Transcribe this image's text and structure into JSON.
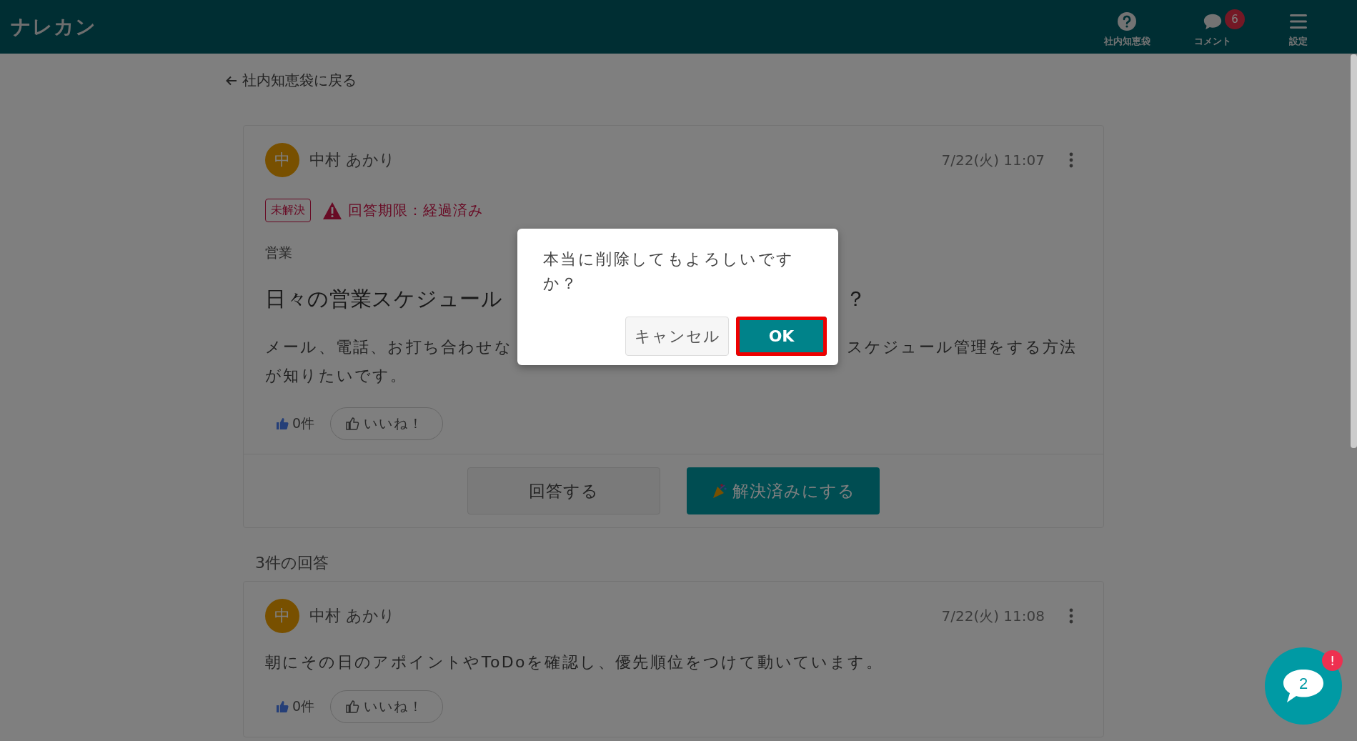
{
  "header": {
    "logo": "ナレカン",
    "nav": [
      {
        "label": "社内知恵袋",
        "kind": "help"
      },
      {
        "label": "コメント",
        "kind": "comment",
        "badge": "6"
      },
      {
        "label": "設定",
        "kind": "menu"
      }
    ]
  },
  "back_link": "社内知恵袋に戻る",
  "question": {
    "avatar": "中",
    "author": "中村 あかり",
    "date": "7/22(火) 11:07",
    "status": "未解決",
    "deadline": "回答期限：経過済み",
    "category": "営業",
    "title_parts": [
      "日々の営業スケジュール",
      "？"
    ],
    "body_lines": [
      [
        "メール、電話、お打ち合わせな",
        "スケジュール管理をする方法"
      ],
      [
        "が知りたいです。"
      ]
    ],
    "like_count": "0件",
    "like_button": "いいね！",
    "actions": [
      {
        "label": "回答する",
        "kind": "secondary"
      },
      {
        "label": "解決済みにする",
        "kind": "primary"
      }
    ]
  },
  "answers_heading": "3件の回答",
  "answers": [
    {
      "avatar": "中",
      "author": "中村 あかり",
      "date": "7/22(火) 11:08",
      "body": "朝にその日のアポイントやToDoを確認し、優先順位をつけて動いています。",
      "like_count": "0件",
      "like_button": "いいね！"
    }
  ],
  "dialog": {
    "message": "本当に削除してもよろしいですか？",
    "buttons": [
      {
        "label": "キャンセル",
        "kind": "secondary",
        "selected": false
      },
      {
        "label": "OK",
        "kind": "primary",
        "selected": true
      }
    ]
  },
  "chat_button": {
    "count": "2",
    "badge": "!"
  }
}
